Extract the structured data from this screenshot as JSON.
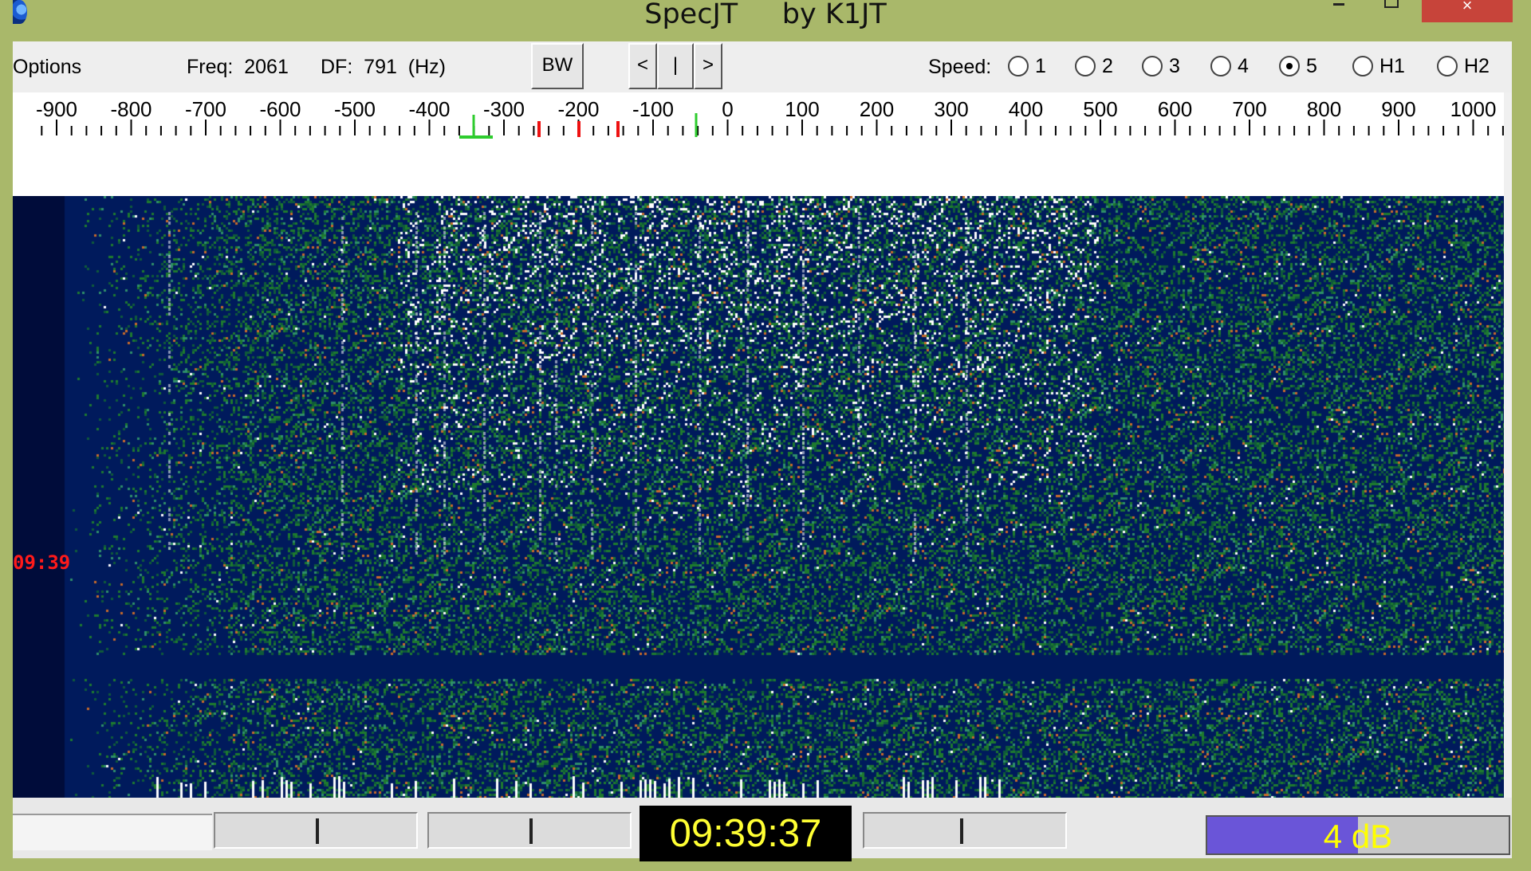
{
  "window": {
    "title": "SpecJT     by K1JT",
    "close_glyph": "×"
  },
  "toolbar": {
    "options_label": "Options",
    "freq_label": "Freq:  2061",
    "df_label": "DF:  791  (Hz)",
    "bw_button": "BW",
    "prev_button": "<",
    "center_button": "|",
    "next_button": ">",
    "speed_label": "Speed:",
    "speed_options": [
      "1",
      "2",
      "3",
      "4",
      "5",
      "H1",
      "H2"
    ],
    "speed_selected": "5"
  },
  "scale": {
    "labels": [
      "-900",
      "-800",
      "-700",
      "-600",
      "-500",
      "-400",
      "-300",
      "-200",
      "-100",
      "0",
      "100",
      "200",
      "300",
      "400",
      "500",
      "600",
      "700",
      "800",
      "900",
      "1000"
    ]
  },
  "spectrogram": {
    "time_mark": "09:39"
  },
  "status": {
    "clock": "09:39:37",
    "level_text": "4 dB",
    "level_fraction": 0.5
  }
}
